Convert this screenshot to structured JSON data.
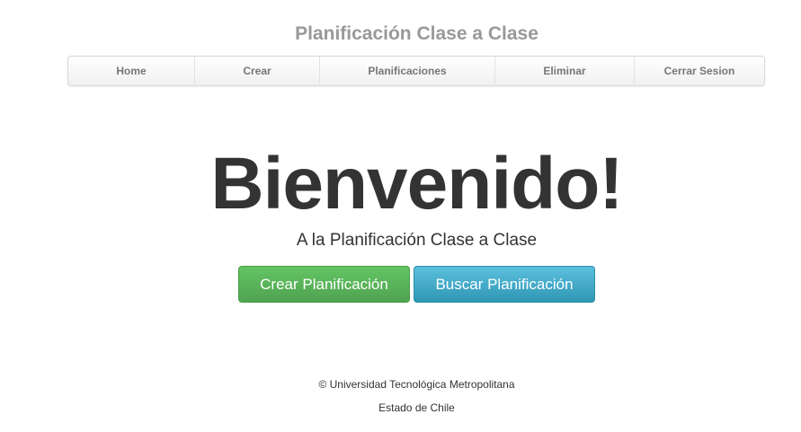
{
  "header": {
    "title": "Planificación Clase a Clase"
  },
  "nav": {
    "items": [
      {
        "label": "Home"
      },
      {
        "label": "Crear"
      },
      {
        "label": "Planificaciones"
      },
      {
        "label": "Eliminar"
      },
      {
        "label": "Cerrar Sesion"
      }
    ]
  },
  "hero": {
    "title": "Bienvenido!",
    "subtitle": "A la Planificación Clase a Clase",
    "primary_button": "Crear Planificación",
    "secondary_button": "Buscar Planificación"
  },
  "footer": {
    "copyright": "© Universidad Tecnológica Metropolitana",
    "line2": "Estado de Chile"
  },
  "colors": {
    "title_gray": "#999999",
    "success_green": "#5bb75b",
    "info_blue": "#49afcd",
    "text_dark": "#333333"
  }
}
